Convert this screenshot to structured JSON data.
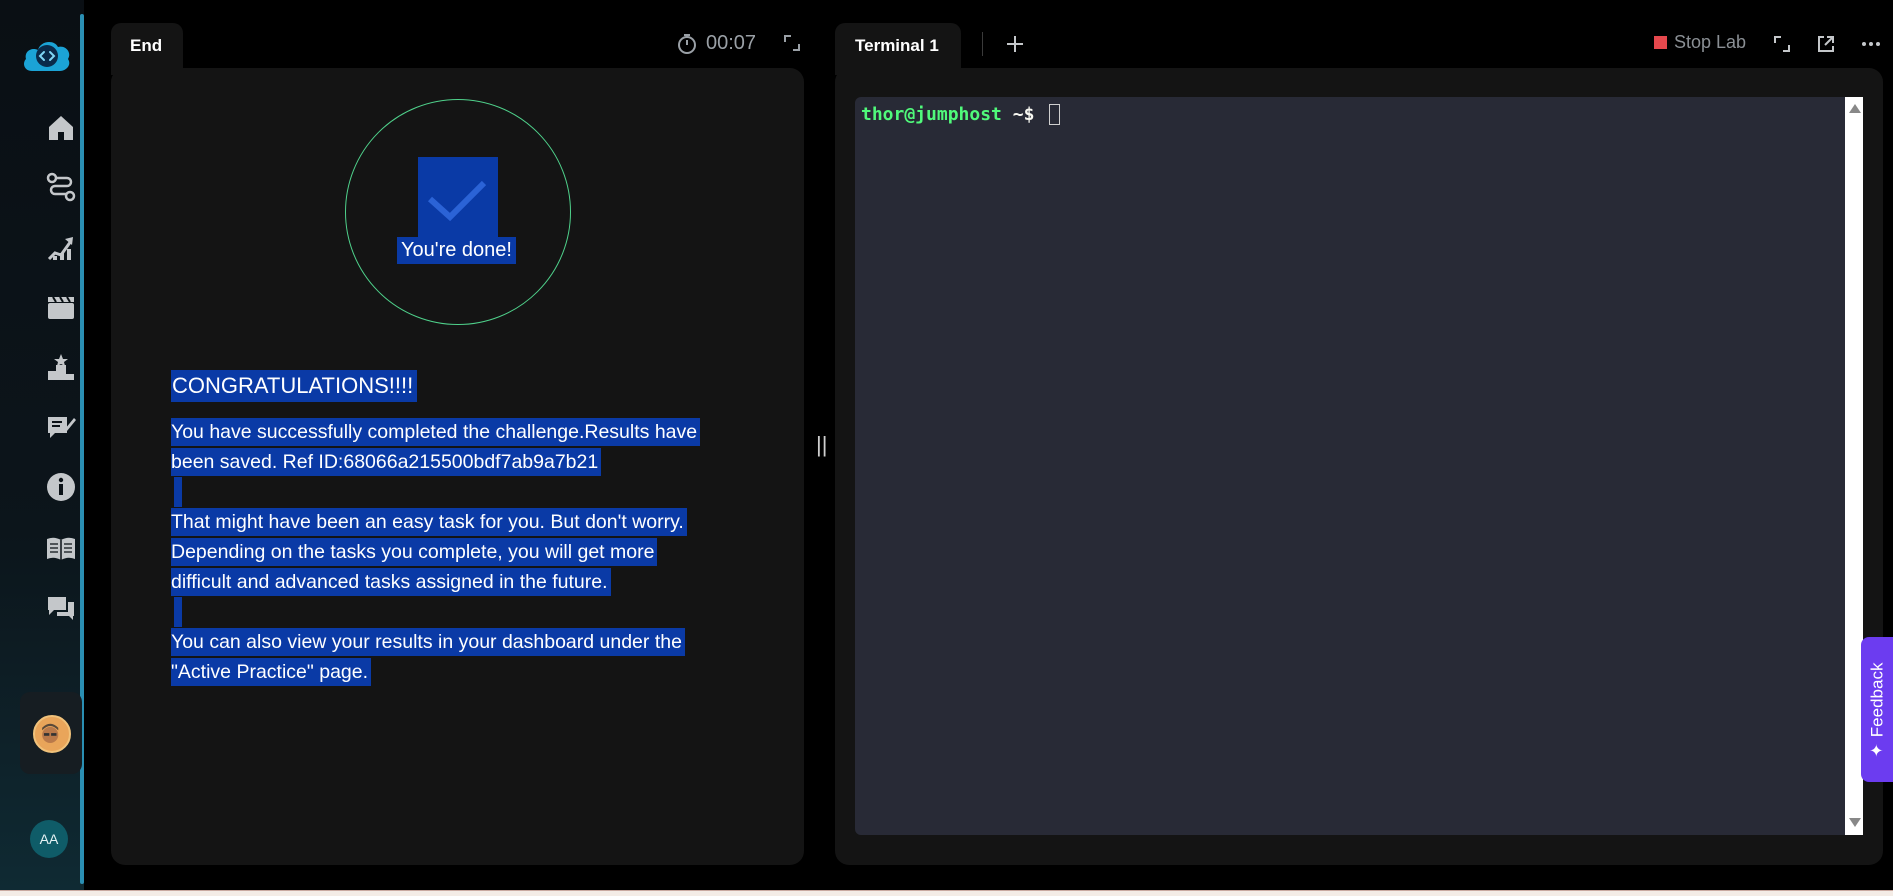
{
  "sidebar": {
    "logo_icon": "cloud-code-icon",
    "nav_items": [
      {
        "icon": "home-icon"
      },
      {
        "icon": "route-icon"
      },
      {
        "icon": "growth-chart-icon"
      },
      {
        "icon": "clapperboard-icon"
      },
      {
        "icon": "leaderboard-icon"
      },
      {
        "icon": "edit-notes-icon"
      },
      {
        "icon": "info-icon"
      },
      {
        "icon": "book-icon"
      },
      {
        "icon": "chat-icon"
      }
    ],
    "user_initials": "AA"
  },
  "left_panel": {
    "tab_label": "End",
    "timer": "00:07",
    "done_label": "You're done!",
    "congrats": "CONGRATULATIONS!!!!",
    "para1_line1": "You have successfully completed the challenge.Results have",
    "para1_line2": "been saved. Ref ID:68066a215500bdf7ab9a7b21",
    "para2_line1": "That might have been an easy task for you. But don't worry.",
    "para2_line2": "Depending on the tasks you complete, you will get more",
    "para2_line3": "difficult and advanced tasks assigned in the future.",
    "para3_line1": "You can also view your results in your dashboard under the",
    "para3_line2": "\"Active Practice\" page."
  },
  "right_panel": {
    "tab_label": "Terminal 1",
    "stop_label": "Stop Lab",
    "prompt_user": "thor@jumphost",
    "prompt_suffix": " ~$"
  },
  "feedback_label": "Feedback",
  "colors": {
    "accent_teal": "#2a8fb3",
    "selection_blue": "#0a3aa6",
    "success_green": "#4fd18b",
    "terminal_bg": "#282a36",
    "feedback_purple": "#6c3cf0",
    "stop_red": "#e5484d"
  }
}
